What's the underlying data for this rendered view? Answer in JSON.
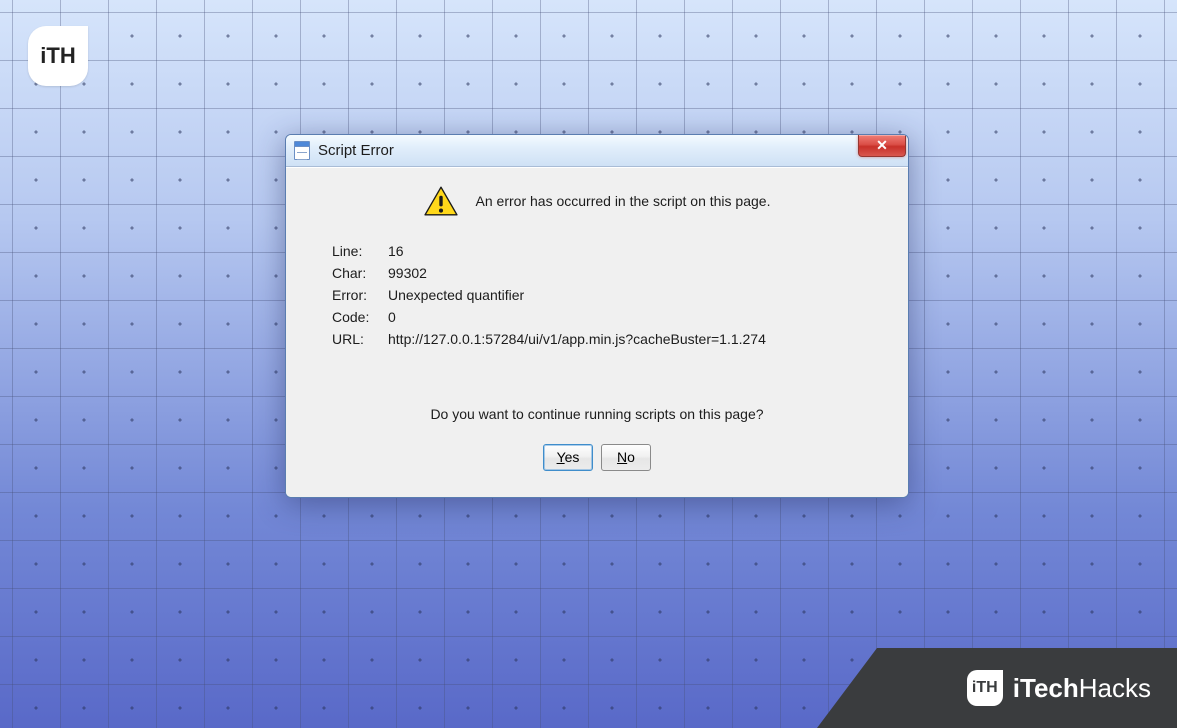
{
  "watermark": {
    "toplogo_text": "iTH",
    "banner_logo_text": "iTH",
    "banner_text_left": "iTech",
    "banner_text_right": "Hacks"
  },
  "dialog": {
    "title": "Script Error",
    "close_label": "✕",
    "message": "An error has occurred in the script on this page.",
    "fields": {
      "line_label": "Line:",
      "line_value": "16",
      "char_label": "Char:",
      "char_value": "99302",
      "error_label": "Error:",
      "error_value": "Unexpected quantifier",
      "code_label": "Code:",
      "code_value": "0",
      "url_label": "URL:",
      "url_value": "http://127.0.0.1:57284/ui/v1/app.min.js?cacheBuster=1.1.274"
    },
    "question": "Do you want to continue running scripts on this page?",
    "yes_prefix": "Y",
    "yes_rest": "es",
    "no_prefix": "N",
    "no_rest": "o"
  }
}
